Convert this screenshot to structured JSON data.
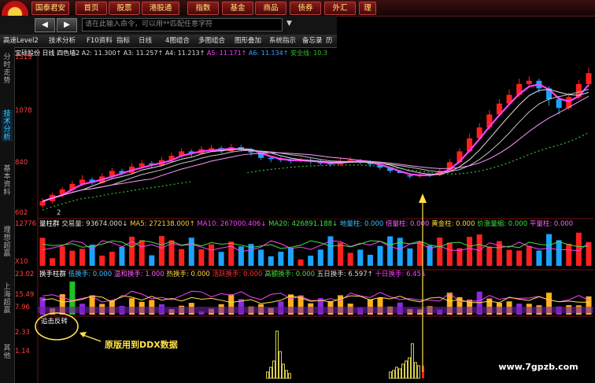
{
  "topbar": {
    "logo_label": "S",
    "items": [
      "国泰君安",
      "首页",
      "股票",
      "港股通",
      "指数",
      "基金",
      "商品",
      "债券",
      "外汇",
      "理"
    ]
  },
  "cmdbar": {
    "back_label": "◀",
    "fwd_label": "▶",
    "placeholder": "请在此输入命令，可以用**匹配任意字符"
  },
  "funcbar": {
    "items": [
      "高速Level2",
      "技术分析",
      "F10资料",
      "指标",
      "日线",
      "4图组合",
      "多图组合",
      "图形叠加",
      "系统指示",
      "备忘录",
      "历史"
    ]
  },
  "sidebar": {
    "tabs": [
      "分时走势",
      "技术分析",
      "基本资料",
      "理想超赢",
      "上海超赢",
      "其他"
    ],
    "active_index": 1
  },
  "price_panel": {
    "stock": "宝硕股份",
    "period": "日线",
    "indicator": "四色墙2",
    "a2": "A2: 11.300↑",
    "a3": "A3: 11.257↑",
    "a4": "A4: 11.213↑",
    "a5": "A5: 11.171↑",
    "a6": "A6: 11.134↑",
    "safe": "安全线: 10.3",
    "y_labels": [
      "1319",
      "1078",
      "840",
      "602"
    ],
    "bottom_label": "2"
  },
  "volume_panel": {
    "title": "量柱群",
    "vol": "交易量: 93674.000↓",
    "ma5": "MA5: 272138.000↑",
    "ma10": "MA10: 267000.406↓",
    "ma20": "MA20: 426891.188↓",
    "dizhu": "地量柱: 0.000",
    "beiliang": "倍量柱: 0.000",
    "huangjin": "黄金柱: 0.000",
    "jiaqiang": "价涨量缩: 0.000",
    "pingliang": "平量柱: 0.000",
    "y_labels": [
      "12776",
      "X10"
    ]
  },
  "turnover_panel": {
    "title": "换手柱群",
    "low": "低换手: 0.000",
    "warm": "温和换手: 1.000",
    "hot": "热换手: 0.000",
    "active": "活跃换手: 0.000",
    "high": "高额换手: 0.000",
    "five": "五日换手: 6.597↑",
    "ten": "十日换手: 6.45↓",
    "y_labels": [
      "23.02",
      "15.49",
      "7.96"
    ]
  },
  "bottom_panel": {
    "title": "追击反转",
    "y_labels": [
      "2.33",
      "1.14"
    ],
    "annotation": "原版用到DDX数据"
  },
  "watermark": "www.7gpzb.com",
  "colors": {
    "up": "#ff2020",
    "down": "#1aa3ff",
    "ma_magenta": "#ff40ff",
    "safe_line": "#30c030",
    "annotation_yellow": "#ffe14a"
  },
  "chart_data": {
    "type": "candlestick",
    "series": [
      {
        "values": [
          {
            "o": 640,
            "c": 660,
            "h": 675,
            "l": 630
          },
          {
            "o": 660,
            "c": 690,
            "h": 700,
            "l": 650
          },
          {
            "o": 690,
            "c": 715,
            "h": 725,
            "l": 680
          },
          {
            "o": 712,
            "c": 740,
            "h": 755,
            "l": 700
          },
          {
            "o": 740,
            "c": 760,
            "h": 780,
            "l": 730
          },
          {
            "o": 760,
            "c": 745,
            "h": 770,
            "l": 735
          },
          {
            "o": 745,
            "c": 775,
            "h": 790,
            "l": 740
          },
          {
            "o": 775,
            "c": 800,
            "h": 815,
            "l": 765
          },
          {
            "o": 800,
            "c": 790,
            "h": 810,
            "l": 780
          },
          {
            "o": 790,
            "c": 820,
            "h": 835,
            "l": 785
          },
          {
            "o": 820,
            "c": 835,
            "h": 850,
            "l": 810
          },
          {
            "o": 835,
            "c": 825,
            "h": 845,
            "l": 815
          },
          {
            "o": 825,
            "c": 850,
            "h": 865,
            "l": 820
          },
          {
            "o": 850,
            "c": 870,
            "h": 885,
            "l": 840
          },
          {
            "o": 870,
            "c": 890,
            "h": 905,
            "l": 860
          },
          {
            "o": 890,
            "c": 880,
            "h": 900,
            "l": 865
          },
          {
            "o": 880,
            "c": 900,
            "h": 915,
            "l": 875
          },
          {
            "o": 900,
            "c": 905,
            "h": 920,
            "l": 890
          },
          {
            "o": 905,
            "c": 890,
            "h": 915,
            "l": 880
          },
          {
            "o": 890,
            "c": 910,
            "h": 925,
            "l": 885
          },
          {
            "o": 910,
            "c": 900,
            "h": 920,
            "l": 890
          },
          {
            "o": 900,
            "c": 885,
            "h": 905,
            "l": 870
          },
          {
            "o": 885,
            "c": 860,
            "h": 890,
            "l": 850
          },
          {
            "o": 860,
            "c": 855,
            "h": 870,
            "l": 840
          },
          {
            "o": 855,
            "c": 850,
            "h": 865,
            "l": 840
          },
          {
            "o": 850,
            "c": 845,
            "h": 860,
            "l": 835
          },
          {
            "o": 845,
            "c": 850,
            "h": 860,
            "l": 838
          },
          {
            "o": 850,
            "c": 842,
            "h": 858,
            "l": 832
          },
          {
            "o": 842,
            "c": 835,
            "h": 850,
            "l": 825
          },
          {
            "o": 835,
            "c": 830,
            "h": 845,
            "l": 820
          },
          {
            "o": 830,
            "c": 845,
            "h": 858,
            "l": 825
          },
          {
            "o": 845,
            "c": 850,
            "h": 862,
            "l": 838
          },
          {
            "o": 850,
            "c": 840,
            "h": 855,
            "l": 830
          },
          {
            "o": 840,
            "c": 830,
            "h": 848,
            "l": 818
          },
          {
            "o": 830,
            "c": 815,
            "h": 835,
            "l": 805
          },
          {
            "o": 815,
            "c": 800,
            "h": 820,
            "l": 790
          },
          {
            "o": 800,
            "c": 780,
            "h": 805,
            "l": 770
          },
          {
            "o": 780,
            "c": 775,
            "h": 790,
            "l": 765
          },
          {
            "o": 775,
            "c": 785,
            "h": 795,
            "l": 768
          },
          {
            "o": 785,
            "c": 780,
            "h": 792,
            "l": 772
          },
          {
            "o": 780,
            "c": 800,
            "h": 812,
            "l": 775
          },
          {
            "o": 800,
            "c": 840,
            "h": 855,
            "l": 795
          },
          {
            "o": 840,
            "c": 890,
            "h": 905,
            "l": 835
          },
          {
            "o": 890,
            "c": 950,
            "h": 970,
            "l": 885
          },
          {
            "o": 950,
            "c": 1000,
            "h": 1020,
            "l": 940
          },
          {
            "o": 1000,
            "c": 1060,
            "h": 1080,
            "l": 990
          },
          {
            "o": 1060,
            "c": 1110,
            "h": 1130,
            "l": 1050
          },
          {
            "o": 1110,
            "c": 1150,
            "h": 1175,
            "l": 1100
          },
          {
            "o": 1150,
            "c": 1200,
            "h": 1225,
            "l": 1140
          },
          {
            "o": 1200,
            "c": 1215,
            "h": 1235,
            "l": 1185
          },
          {
            "o": 1215,
            "c": 1180,
            "h": 1225,
            "l": 1160
          },
          {
            "o": 1180,
            "c": 1130,
            "h": 1190,
            "l": 1100
          },
          {
            "o": 1130,
            "c": 1090,
            "h": 1145,
            "l": 1060
          },
          {
            "o": 1090,
            "c": 1140,
            "h": 1160,
            "l": 1080
          },
          {
            "o": 1140,
            "c": 1200,
            "h": 1220,
            "l": 1130
          },
          {
            "o": 1200,
            "c": 1250,
            "h": 1275,
            "l": 1190
          }
        ]
      }
    ],
    "ylim": [
      602,
      1319
    ]
  }
}
